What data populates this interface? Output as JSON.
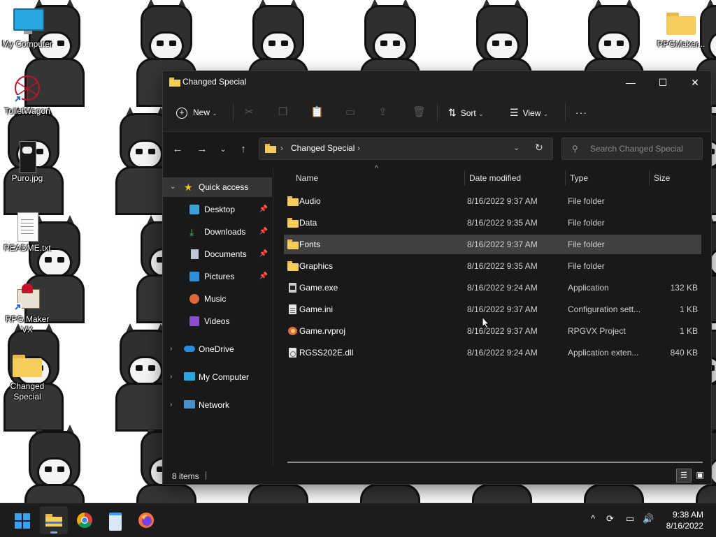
{
  "desktop": {
    "icons": [
      {
        "label": "My Computer"
      },
      {
        "label": "ToiletWagon"
      },
      {
        "label": "Puro.jpg"
      },
      {
        "label": "README.txt"
      },
      {
        "label": "RPG Maker VX"
      },
      {
        "label": "Changed Special"
      },
      {
        "label": "RPGMaker..."
      }
    ]
  },
  "window": {
    "title": "Changed Special",
    "commands": {
      "new_label": "New",
      "sort_label": "Sort",
      "view_label": "View",
      "more_label": "···"
    },
    "address": {
      "path": "Changed Special",
      "search_placeholder": "Search Changed Special"
    },
    "nav": {
      "quick_access": "Quick access",
      "items": [
        {
          "label": "Desktop",
          "icon": "desktop-icon",
          "pinned": true
        },
        {
          "label": "Downloads",
          "icon": "download-icon",
          "pinned": true
        },
        {
          "label": "Documents",
          "icon": "document-icon",
          "pinned": true
        },
        {
          "label": "Pictures",
          "icon": "pictures-icon",
          "pinned": true
        },
        {
          "label": "Music",
          "icon": "music-icon",
          "pinned": false
        },
        {
          "label": "Videos",
          "icon": "videos-icon",
          "pinned": false
        }
      ],
      "onedrive": "OneDrive",
      "my_computer": "My Computer",
      "network": "Network"
    },
    "columns": {
      "name": "Name",
      "date": "Date modified",
      "type": "Type",
      "size": "Size"
    },
    "files": [
      {
        "name": "Audio",
        "date": "8/16/2022 9:37 AM",
        "type": "File folder",
        "size": "",
        "kind": "folder"
      },
      {
        "name": "Data",
        "date": "8/16/2022 9:35 AM",
        "type": "File folder",
        "size": "",
        "kind": "folder"
      },
      {
        "name": "Fonts",
        "date": "8/16/2022 9:37 AM",
        "type": "File folder",
        "size": "",
        "kind": "folder",
        "selected": true
      },
      {
        "name": "Graphics",
        "date": "8/16/2022 9:35 AM",
        "type": "File folder",
        "size": "",
        "kind": "folder"
      },
      {
        "name": "Game.exe",
        "date": "8/16/2022 9:24 AM",
        "type": "Application",
        "size": "132 KB",
        "kind": "exe"
      },
      {
        "name": "Game.ini",
        "date": "8/16/2022 9:37 AM",
        "type": "Configuration sett...",
        "size": "1 KB",
        "kind": "ini"
      },
      {
        "name": "Game.rvproj",
        "date": "8/16/2022 9:37 AM",
        "type": "RPGVX Project",
        "size": "1 KB",
        "kind": "proj"
      },
      {
        "name": "RGSS202E.dll",
        "date": "8/16/2022 9:24 AM",
        "type": "Application exten...",
        "size": "840 KB",
        "kind": "dll"
      }
    ],
    "status": "8 items"
  },
  "taskbar": {
    "apps": [
      "start-icon",
      "file-explorer-icon",
      "chrome-icon",
      "notepad-icon",
      "firefox-icon"
    ],
    "time": "9:38 AM",
    "date": "8/16/2022"
  },
  "colors": {
    "accent": "#7aa7d8",
    "folder": "#f5cd5a",
    "window_bg": "#191919",
    "selection": "#414141"
  }
}
